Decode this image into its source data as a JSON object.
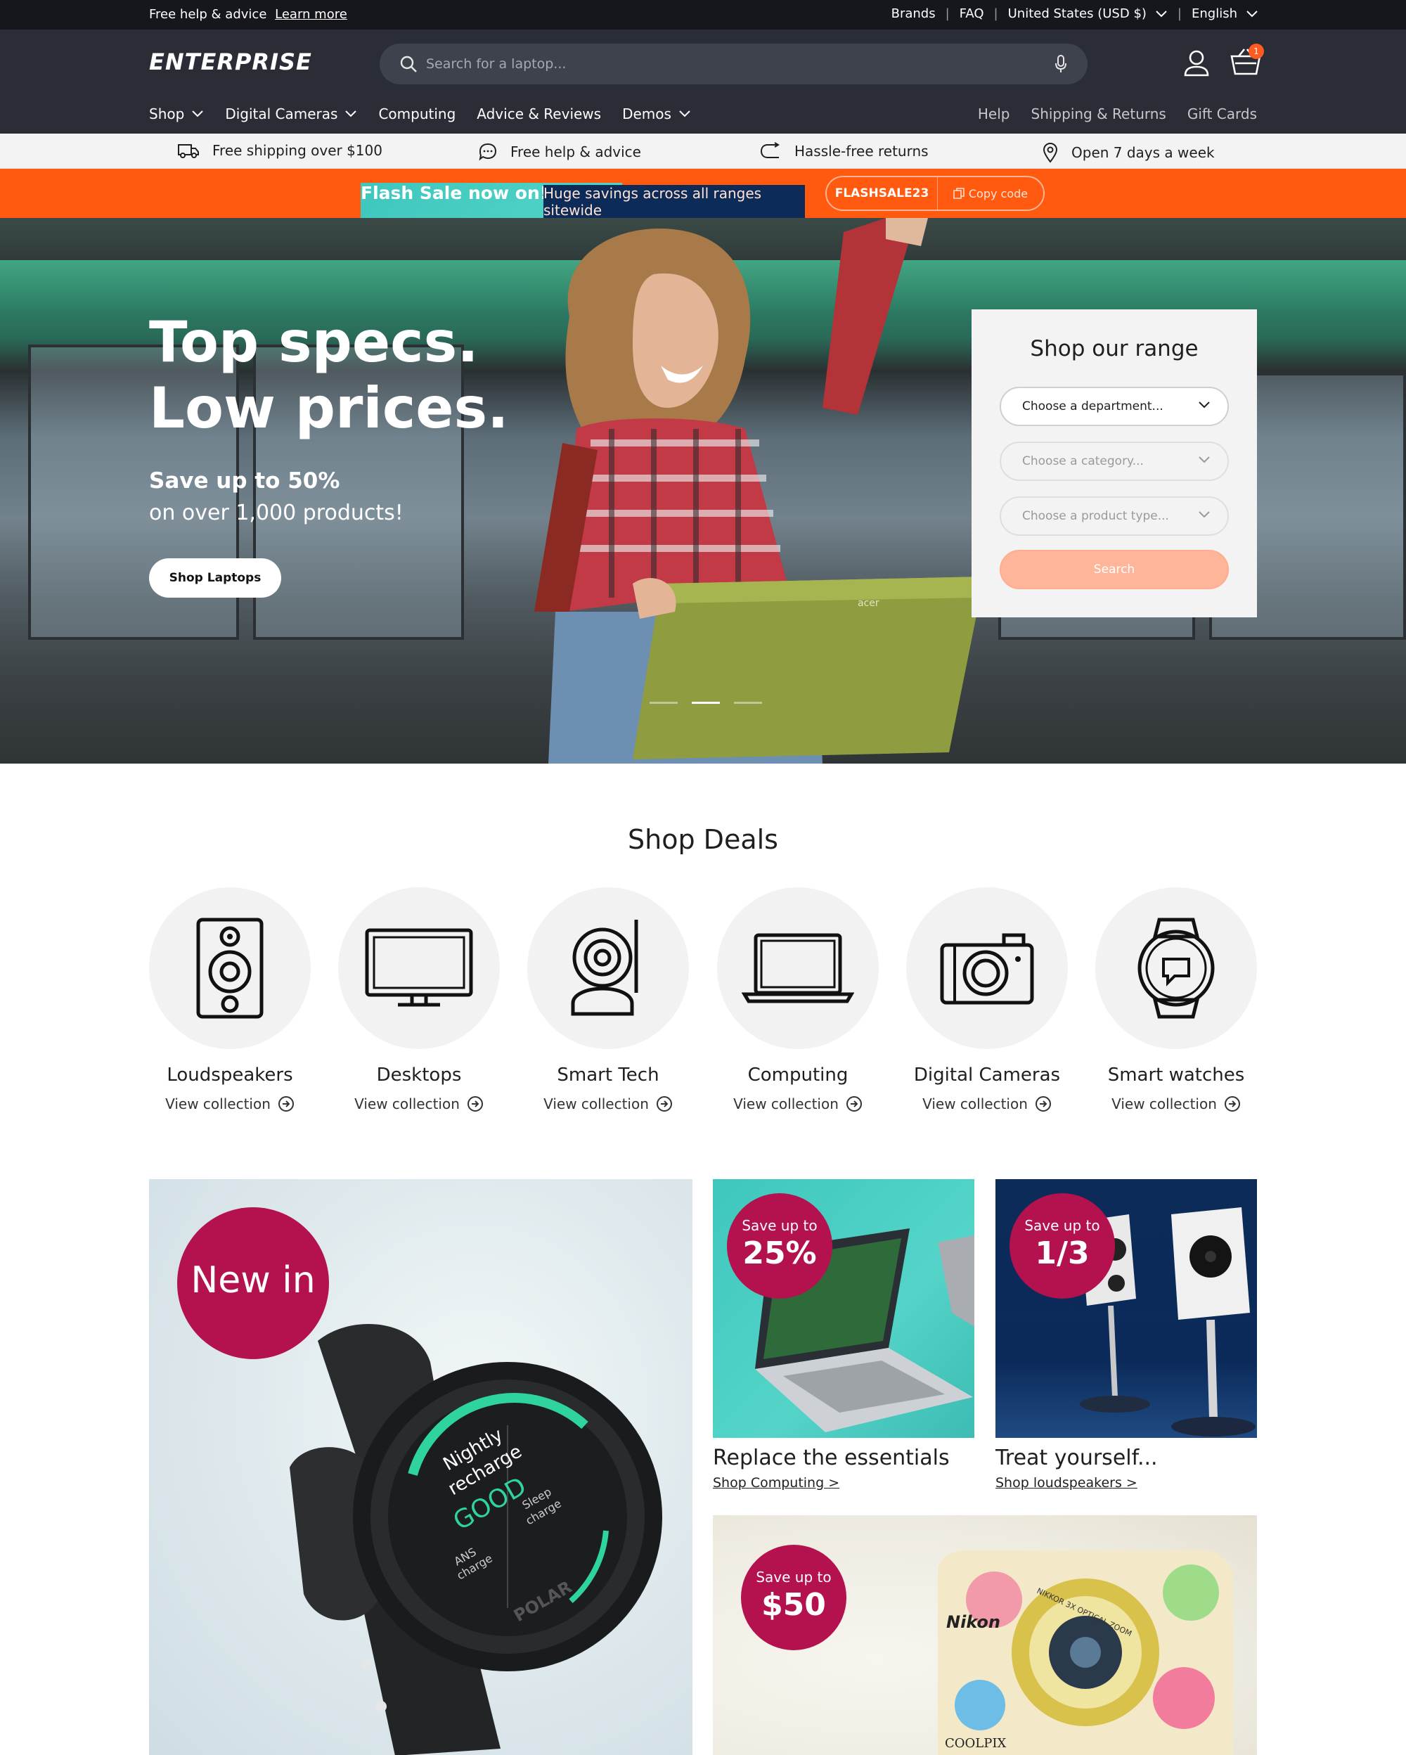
{
  "utility_bar": {
    "help_text": "Free help & advice",
    "learn_more": "Learn more",
    "links": [
      "Brands",
      "FAQ"
    ],
    "currency": "United States (USD $)",
    "language": "English"
  },
  "header": {
    "logo": "ENTERPRISE",
    "search_placeholder": "Search for a laptop...",
    "cart_count": "1",
    "nav": [
      "Shop",
      "Digital Cameras",
      "Computing",
      "Advice & Reviews",
      "Demos"
    ],
    "nav_right": [
      "Help",
      "Shipping & Returns",
      "Gift Cards"
    ]
  },
  "usp": [
    "Free shipping over $100",
    "Free help & advice",
    "Hassle-free returns",
    "Open 7 days a week"
  ],
  "flash": {
    "title": "Flash Sale now on!",
    "text": "Huge savings across all ranges sitewide",
    "code": "FLASHSALE23",
    "copy": "Copy code"
  },
  "hero": {
    "line1": "Top specs.",
    "line2": "Low prices.",
    "sub1": "Save up to 50%",
    "sub2": "on over 1,000 products!",
    "cta": "Shop Laptops",
    "laptop_brand": "acer"
  },
  "range": {
    "title": "Shop our range",
    "department": "Choose a department...",
    "category": "Choose a category...",
    "product_type": "Choose a product type...",
    "search": "Search"
  },
  "deals": {
    "title": "Shop Deals",
    "view_label": "View collection",
    "items": [
      {
        "name": "Loudspeakers",
        "icon": "speaker-icon"
      },
      {
        "name": "Desktops",
        "icon": "monitor-icon"
      },
      {
        "name": "Smart Tech",
        "icon": "smart-camera-icon"
      },
      {
        "name": "Computing",
        "icon": "laptop-icon"
      },
      {
        "name": "Digital Cameras",
        "icon": "camera-icon"
      },
      {
        "name": "Smart watches",
        "icon": "smartwatch-icon"
      }
    ]
  },
  "promos": {
    "big": {
      "badge": "New in"
    },
    "watch_text": {
      "l1": "Nightly",
      "l2": "recharge",
      "l3": "GOOD",
      "l4": "ANS",
      "l5": "charge",
      "l6": "Sleep",
      "l7": "charge",
      "brand": "POLAR"
    },
    "tile1": {
      "badge_small": "Save up to",
      "badge_big": "25%",
      "caption": "Replace the essentials",
      "link": "Shop Computing >"
    },
    "tile2": {
      "badge_small": "Save up to",
      "badge_big": "1/3",
      "caption": "Treat yourself...",
      "link": "Shop loudspeakers >"
    },
    "tile3": {
      "badge_small": "Save up to",
      "badge_big": "$50",
      "camera_brand": "Nikon",
      "camera_model": "COOLPIX",
      "camera_lens": "NIKKOR 3X OPTICAL ZOOM"
    }
  }
}
